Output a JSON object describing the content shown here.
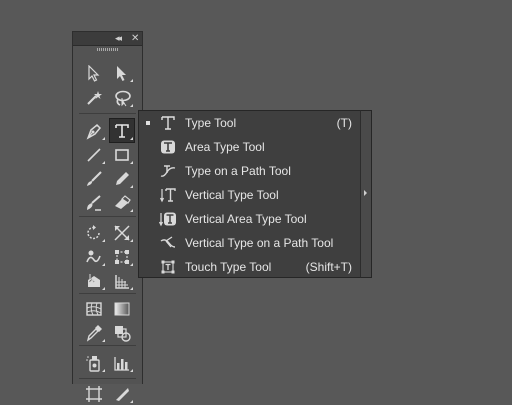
{
  "panel": {
    "collapse_glyph": "◂◂",
    "close_glyph": "✕"
  },
  "tools": [
    {
      "name": "selection-tool-icon"
    },
    {
      "name": "direct-selection-tool-icon"
    },
    {
      "name": "magic-wand-tool-icon"
    },
    {
      "name": "lasso-tool-icon"
    },
    {
      "name": "pen-tool-icon"
    },
    {
      "name": "type-tool-icon"
    },
    {
      "name": "line-segment-tool-icon"
    },
    {
      "name": "rectangle-tool-icon"
    },
    {
      "name": "paintbrush-tool-icon"
    },
    {
      "name": "pencil-tool-icon"
    },
    {
      "name": "blob-brush-tool-icon"
    },
    {
      "name": "eraser-tool-icon"
    },
    {
      "name": "rotate-tool-icon"
    },
    {
      "name": "scale-tool-icon"
    },
    {
      "name": "warp-tool-icon"
    },
    {
      "name": "free-transform-tool-icon"
    },
    {
      "name": "shape-builder-tool-icon"
    },
    {
      "name": "perspective-grid-tool-icon"
    },
    {
      "name": "mesh-tool-icon"
    },
    {
      "name": "gradient-tool-icon"
    },
    {
      "name": "eyedropper-tool-icon"
    },
    {
      "name": "blend-tool-icon"
    },
    {
      "name": "symbol-sprayer-tool-icon"
    },
    {
      "name": "column-graph-tool-icon"
    },
    {
      "name": "artboard-tool-icon"
    },
    {
      "name": "slice-tool-icon"
    }
  ],
  "flyout": {
    "items": [
      {
        "label": "Type Tool",
        "shortcut": "(T)",
        "selected": true,
        "icon": "type-tool-icon"
      },
      {
        "label": "Area Type Tool",
        "shortcut": "",
        "selected": false,
        "icon": "area-type-tool-icon"
      },
      {
        "label": "Type on a Path Tool",
        "shortcut": "",
        "selected": false,
        "icon": "type-on-path-tool-icon"
      },
      {
        "label": "Vertical Type Tool",
        "shortcut": "",
        "selected": false,
        "icon": "vertical-type-tool-icon"
      },
      {
        "label": "Vertical Area Type Tool",
        "shortcut": "",
        "selected": false,
        "icon": "vertical-area-type-tool-icon"
      },
      {
        "label": "Vertical Type on a Path Tool",
        "shortcut": "",
        "selected": false,
        "icon": "vertical-type-on-path-tool-icon"
      },
      {
        "label": "Touch Type Tool",
        "shortcut": "(Shift+T)",
        "selected": false,
        "icon": "touch-type-tool-icon"
      }
    ]
  },
  "colors": {
    "canvas": "#585858",
    "panel": "#535353",
    "flyout": "#3f3f3f",
    "icon": "#d9d9d9",
    "text": "#e6e6e6"
  }
}
